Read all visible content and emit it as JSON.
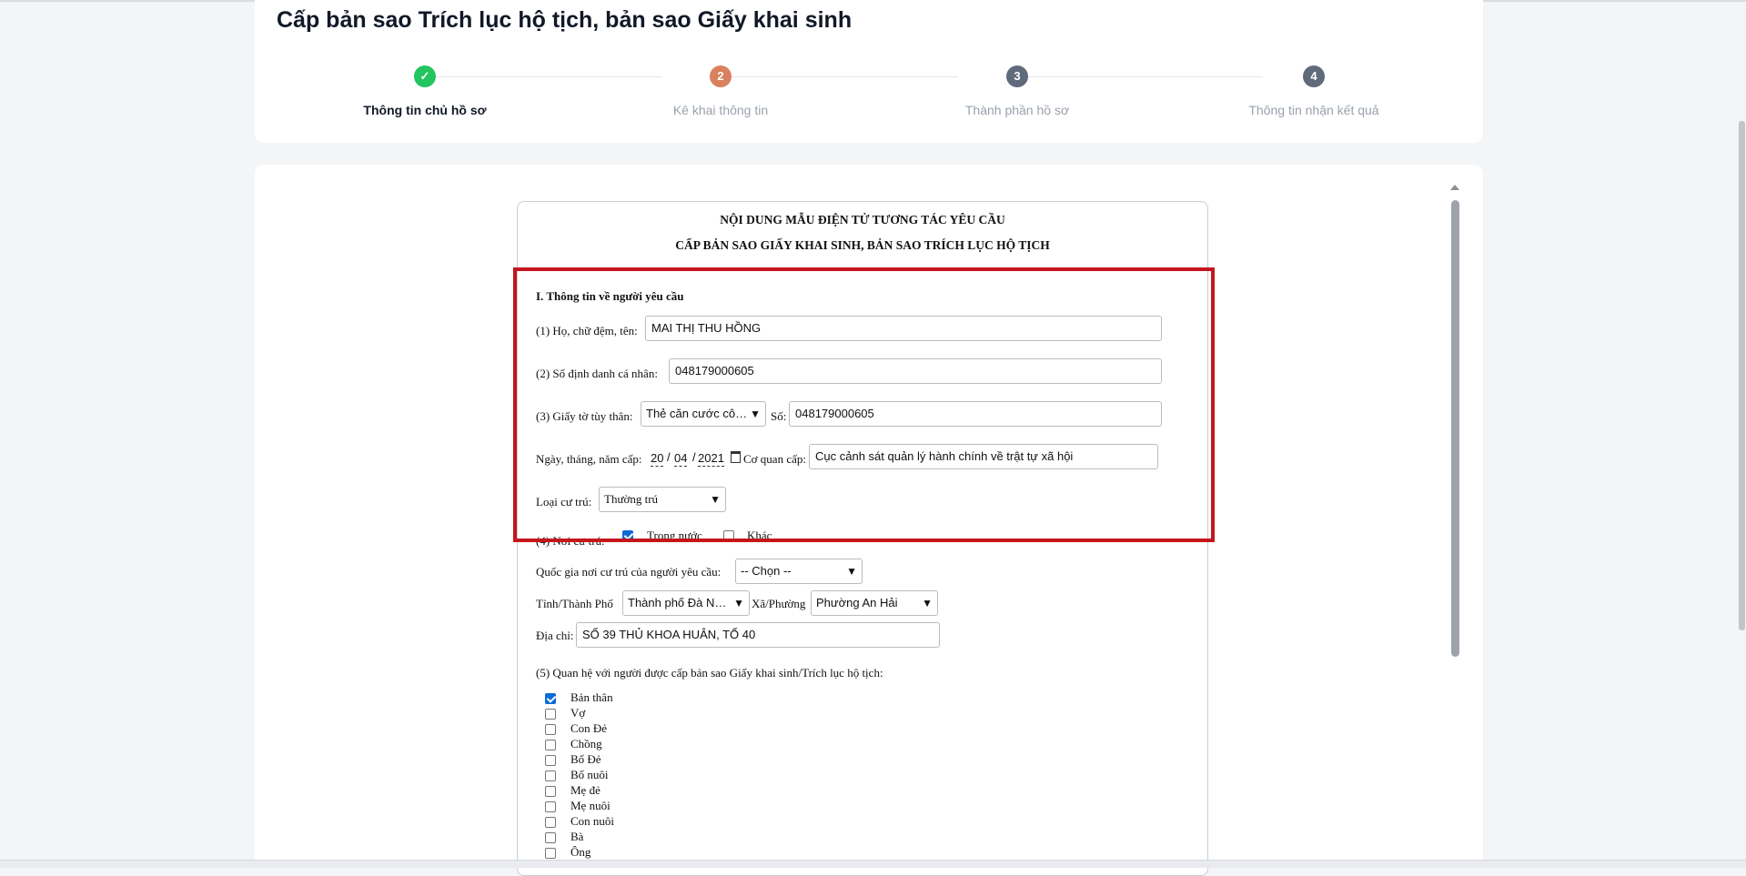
{
  "page": {
    "title": "Cấp bản sao Trích lục hộ tịch, bản sao Giấy khai sinh"
  },
  "steps": [
    {
      "number": "✓",
      "label": "Thông tin chủ hồ sơ",
      "state": "done",
      "color": "#22c55e"
    },
    {
      "number": "2",
      "label": "Kê khai thông tin",
      "state": "active",
      "color": "#d9805f"
    },
    {
      "number": "3",
      "label": "Thành phần hồ sơ",
      "state": "pending",
      "color": "#5f6b7a"
    },
    {
      "number": "4",
      "label": "Thông tin nhận kết quả",
      "state": "pending",
      "color": "#5f6b7a"
    }
  ],
  "form": {
    "title_line1": "NỘI DUNG MẪU ĐIỆN TỬ TƯƠNG TÁC YÊU CẦU",
    "title_line2": "CẤP BẢN SAO GIẤY KHAI SINH, BẢN SAO TRÍCH LỤC HỘ TỊCH",
    "section1": "I. Thông tin về người yêu cầu",
    "name_label": "(1) Họ, chữ đệm, tên:",
    "name_value": "MAI THỊ THU HỒNG",
    "id_label": "(2) Số định danh cá nhân:",
    "id_value": "048179000605",
    "doc_label": "(3) Giấy tờ tùy thân:",
    "doc_type": "Thẻ căn cước cô…",
    "doc_no_label": "Số:",
    "doc_no_value": "048179000605",
    "issue_date_label": "Ngày, tháng, năm cấp:",
    "issue_day": "20",
    "issue_month": "04",
    "issue_year": "2021",
    "issuer_label": "Cơ quan cấp:",
    "issuer_value": "Cục cảnh sát quản lý hành chính về trật tự xã hội",
    "residence_type_label": "Loại cư trú:",
    "residence_type_value": "Thường trú",
    "residence_label": "(4) Nơi cư trú:",
    "residence_domestic": "Trong nước",
    "residence_other": "Khác",
    "country_label": "Quốc gia nơi cư trú của người yêu cầu:",
    "country_value": "-- Chọn --",
    "province_label": "Tỉnh/Thành Phố",
    "province_value": "Thành phố Đà N…",
    "ward_label": "Xã/Phường",
    "ward_value": "Phường An Hải",
    "address_label": "Địa chỉ:",
    "address_value": "SỐ 39 THỦ KHOA HUÂN, TỔ 40",
    "relation_label": "(5) Quan hệ với người được cấp bản sao Giấy khai sinh/Trích lục hộ tịch:",
    "relations": [
      {
        "label": "Bản thân",
        "checked": true
      },
      {
        "label": "Vợ",
        "checked": false
      },
      {
        "label": "Con Đẻ",
        "checked": false
      },
      {
        "label": "Chồng",
        "checked": false
      },
      {
        "label": "Bố Đẻ",
        "checked": false
      },
      {
        "label": "Bố nuôi",
        "checked": false
      },
      {
        "label": "Mẹ đẻ",
        "checked": false
      },
      {
        "label": "Mẹ nuôi",
        "checked": false
      },
      {
        "label": "Con nuôi",
        "checked": false
      },
      {
        "label": "Bà",
        "checked": false
      },
      {
        "label": "Ông",
        "checked": false
      }
    ]
  },
  "icons": {
    "dropdown": "▼",
    "calendar": "calendar-icon",
    "check": "check-icon"
  },
  "colors": {
    "highlight": "#c4161c",
    "done": "#22c55e",
    "active": "#d9805f",
    "pending": "#5f6b7a"
  }
}
